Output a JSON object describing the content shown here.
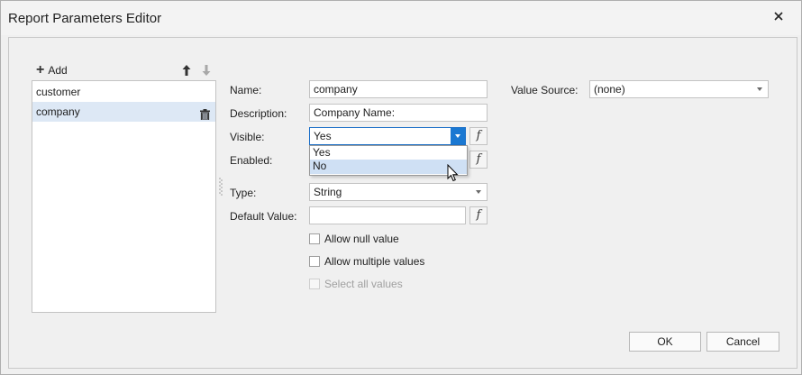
{
  "window": {
    "title": "Report Parameters Editor"
  },
  "toolbar": {
    "add_label": "Add"
  },
  "parameters": [
    {
      "label": "customer",
      "selected": false
    },
    {
      "label": "company",
      "selected": true
    }
  ],
  "fields": {
    "name": {
      "label": "Name:",
      "value": "company"
    },
    "description": {
      "label": "Description:",
      "value": "Company Name:"
    },
    "visible": {
      "label": "Visible:",
      "value": "Yes"
    },
    "enabled": {
      "label": "Enabled:"
    },
    "type": {
      "label": "Type:",
      "value": "String"
    },
    "default_value": {
      "label": "Default Value:",
      "value": ""
    },
    "value_source": {
      "label": "Value Source:",
      "value": "(none)"
    }
  },
  "visible_dropdown": {
    "options": [
      "Yes",
      "No"
    ],
    "highlighted": "No"
  },
  "checkboxes": {
    "allow_null": {
      "label": "Allow null value",
      "checked": false
    },
    "allow_multiple": {
      "label": "Allow multiple values",
      "checked": false
    },
    "select_all": {
      "label": "Select all values",
      "checked": false,
      "disabled": true
    }
  },
  "buttons": {
    "ok": "OK",
    "cancel": "Cancel"
  },
  "colors": {
    "accent": "#1a78d2",
    "selection": "#dde8f5",
    "highlight": "#cfe0f4"
  }
}
